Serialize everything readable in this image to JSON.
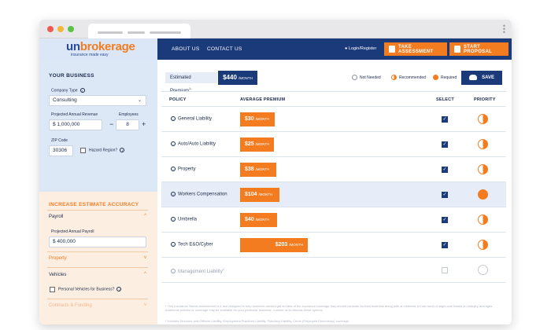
{
  "nav": {
    "logo_prefix": "un",
    "logo_suffix": "brokerage",
    "logo_tagline": "insurance made easy",
    "links": [
      "ABOUT US",
      "CONTACT US"
    ],
    "login": "Login/Register",
    "take_assessment": "TAKE ASSESSMENT",
    "start_proposal": "START PROPOSAL"
  },
  "sidebar": {
    "title": "YOUR BUSINESS",
    "company_type_label": "Company Type",
    "company_type_value": "Consulting",
    "revenue_label": "Projected Annual Revenue",
    "revenue_value": "$ 1,000,000",
    "employees_label": "Employees",
    "employees_value": "8",
    "zip_label": "ZIP Code",
    "zip_value": "30306",
    "hazard_label": "Hazard Region?",
    "accuracy_title": "INCREASE ESTIMATE ACCURACY",
    "sections": {
      "payroll": "Payroll",
      "payroll_field_label": "Projected Annual Payroll",
      "payroll_value": "$ 400,000",
      "property": "Property",
      "vehicles": "Vehicles",
      "personal_vehicles": "Personal Vehicles for Business?",
      "contracts": "Contracts & Funding"
    }
  },
  "main": {
    "estimated_label": "Estimated Premium",
    "estimated_value": "$440",
    "estimated_unit": "/MONTH",
    "legend": [
      "Not Needed",
      "Recommended",
      "Required"
    ],
    "save": "SAVE",
    "columns": [
      "POLICY",
      "AVERAGE PREMIUM",
      "SELECT",
      "PRIORITY"
    ],
    "rows": [
      {
        "policy": "General Liability",
        "premium": "$30",
        "unit": "/MONTH",
        "selected": true,
        "priority": "recommended"
      },
      {
        "policy": "Auto/Auto Liability",
        "premium": "$25",
        "unit": "/MONTH",
        "selected": true,
        "priority": "recommended"
      },
      {
        "policy": "Property",
        "premium": "$38",
        "unit": "/MONTH",
        "selected": true,
        "priority": "recommended"
      },
      {
        "policy": "Workers Compensation",
        "premium": "$104",
        "unit": "/MONTH",
        "selected": true,
        "priority": "required"
      },
      {
        "policy": "Umbrella",
        "premium": "$40",
        "unit": "/MONTH",
        "selected": true,
        "priority": "recommended"
      },
      {
        "policy": "Tech E&O/Cyber",
        "premium": "$203",
        "unit": "/MONTH",
        "selected": true,
        "priority": "recommended"
      },
      {
        "policy": "Management Liability",
        "premium": "",
        "unit": "",
        "selected": false,
        "priority": "not-needed"
      }
    ],
    "footnote1": "* This Insurance Needs Assessment is a tool designed to help business owners get an idea of the insurance coverage they should consider for their business along with an estimate of how much it might cost based on industry averages. Additional policies or coverage may be available for your particular business. Contact us to discuss these options.",
    "footnote2": "² Includes Directors and Officers Liability, Employment Practices Liability, Fiduciary Liability, Crime (Employee Dishonesty) coverage."
  }
}
